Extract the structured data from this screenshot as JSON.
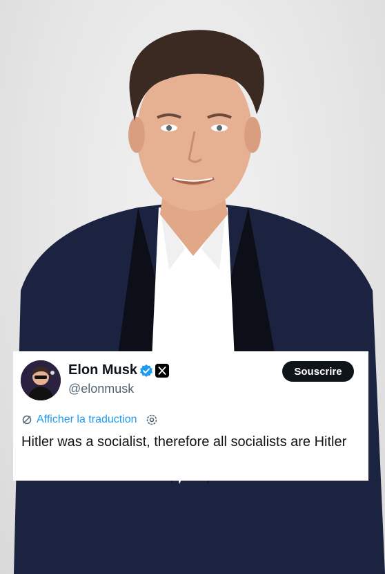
{
  "tweet": {
    "author_name": "Elon Musk",
    "handle": "@elonmusk",
    "subscribe_label": "Souscrire",
    "translate_label": "Afficher la traduction",
    "text": "Hitler was a socialist, therefore all socialists are Hitler"
  },
  "icons": {
    "verified": "verified-badge-icon",
    "platform": "x-logo-icon",
    "translate": "translate-icon",
    "settings": "gear-icon"
  },
  "colors": {
    "accent_blue": "#1d9bf0",
    "button_dark": "#0f1419",
    "handle_gray": "#536471",
    "suit": "#1c2340"
  }
}
